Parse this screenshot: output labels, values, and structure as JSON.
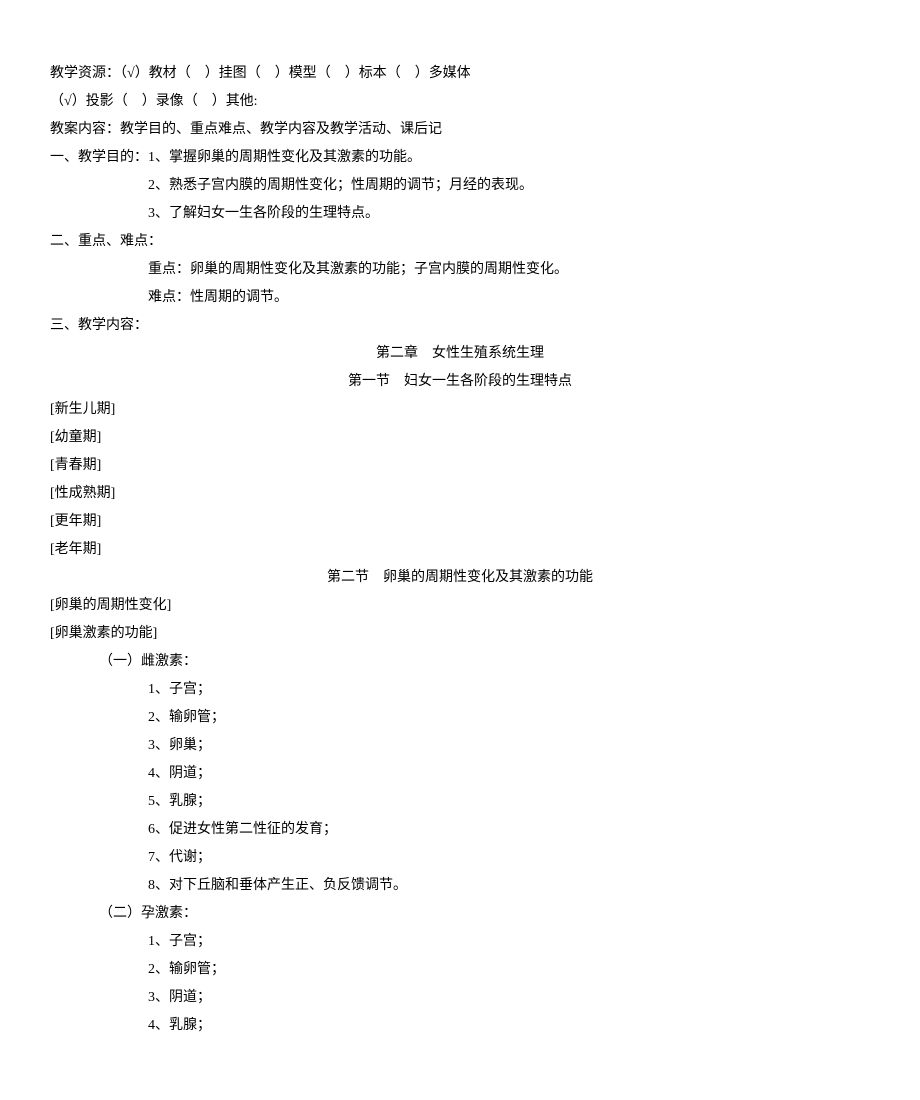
{
  "resources": {
    "label": "教学资源：",
    "options": [
      {
        "mark": "√",
        "name": "教材"
      },
      {
        "mark": "",
        "name": "挂图"
      },
      {
        "mark": "",
        "name": "模型"
      },
      {
        "mark": "",
        "name": "标本"
      },
      {
        "mark": "",
        "name": "多媒体"
      }
    ],
    "options2": [
      {
        "mark": "√",
        "name": "投影"
      },
      {
        "mark": "",
        "name": "录像"
      },
      {
        "mark": "",
        "name": "其他:"
      }
    ]
  },
  "plan_content": "教案内容：教学目的、重点难点、教学内容及教学活动、课后记",
  "objectives": {
    "label": "一、教学目的：",
    "items": [
      "1、掌握卵巢的周期性变化及其激素的功能。",
      "2、熟悉子宫内膜的周期性变化；性周期的调节；月经的表现。",
      "3、了解妇女一生各阶段的生理特点。"
    ]
  },
  "key_points": {
    "label": "二、重点、难点：",
    "focus_label": "重点：",
    "focus": "卵巢的周期性变化及其激素的功能；子宫内膜的周期性变化。",
    "difficulty_label": "难点：",
    "difficulty": "性周期的调节。"
  },
  "teaching_content": {
    "label": "三、教学内容：",
    "chapter_title": "第二章　女性生殖系统生理",
    "section1": {
      "title": "第一节　妇女一生各阶段的生理特点",
      "periods": [
        "[新生儿期]",
        "[幼童期]",
        "[青春期]",
        "[性成熟期]",
        "[更年期]",
        "[老年期]"
      ]
    },
    "section2": {
      "title": "第二节　卵巢的周期性变化及其激素的功能",
      "topics": [
        "[卵巢的周期性变化]",
        "[卵巢激素的功能]"
      ],
      "estrogen": {
        "label": "（一）雌激素：",
        "items": [
          "1、子宫；",
          "2、输卵管；",
          "3、卵巢；",
          "4、阴道；",
          "5、乳腺；",
          "6、促进女性第二性征的发育；",
          "7、代谢；",
          "8、对下丘脑和垂体产生正、负反馈调节。"
        ]
      },
      "progesterone": {
        "label": "（二）孕激素：",
        "items": [
          "1、子宫；",
          "2、输卵管；",
          "3、阴道；",
          "4、乳腺；"
        ]
      }
    }
  }
}
